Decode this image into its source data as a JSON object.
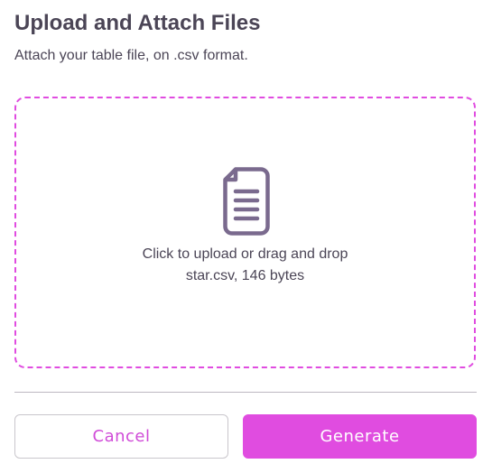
{
  "dialog": {
    "title": "Upload and Attach Files",
    "subtitle": "Attach your table file, on .csv format."
  },
  "dropzone": {
    "icon": "file-document-icon",
    "label": "Click to upload or drag and drop",
    "file_info": "star.csv, 146 bytes",
    "border_color": "#e04ce0"
  },
  "actions": {
    "cancel_label": "Cancel",
    "generate_label": "Generate"
  },
  "colors": {
    "accent": "#e04ce0",
    "text": "#4b4556",
    "icon": "#7a6a8e"
  }
}
